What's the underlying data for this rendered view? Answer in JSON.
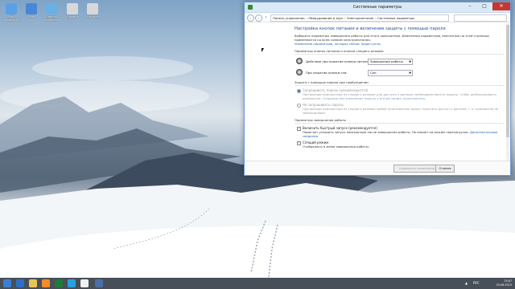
{
  "desktop": {
    "icons": [
      {
        "label": "Этот компьютер",
        "color": "#5aa0e8"
      },
      {
        "label": "Сеть",
        "color": "#4a86d8"
      },
      {
        "label": "Панель управления",
        "color": "#6ab0e6"
      },
      {
        "label": "Корзина",
        "color": "#d8d8d8"
      },
      {
        "label": "Корзина",
        "color": "#d8d8d8"
      }
    ]
  },
  "window": {
    "title": "Системные параметры",
    "breadcrumbs": [
      "Панель управления",
      "Оборудование и звук",
      "Электропитание",
      "Системные параметры"
    ],
    "heading": "Настройка кнопок питания и включение защиты с помощью пароля",
    "intro": "Выберите параметры завершения работы для этого компьютера. Изменения параметров, внесенные на этой странице, применяются ко всем схемам электропитания.",
    "change_link": "Изменение параметров, которые сейчас недоступны",
    "power_section": "Параметры кнопок питания и кнопки спящего режима",
    "power_label": "Действие при нажатии кнопки питания:",
    "power_value": "Завершение работы",
    "sleep_label": "При нажатии кнопки сна:",
    "sleep_value": "Сон",
    "wake_section": "Защита с помощью пароля при пробуждении",
    "require_label": "Запрашивать пароль (рекомендуется)",
    "require_desc": "При выходе компьютера из спящего режима для доступа к данным необходимо ввести пароль, чтобы разблокировать компьютер.",
    "require_link": "Создание или изменение пароля учетной записи пользователя",
    "norequire_label": "Не запрашивать пароль",
    "norequire_desc": "При выходе компьютера из спящего режима любой пользователь может получить доступ к данным, т. к. компьютер не заблокирован.",
    "shutdown_section": "Параметры завершения работы",
    "fast_label": "Включить быстрый запуск (рекомендуется)",
    "fast_desc": "Помогает ускорить запуск компьютера после завершения работы. Не влияет на режим перезагрузки.",
    "fast_link": "Дополнительные сведения",
    "sleep_cb_label": "Спящий режим",
    "sleep_cb_desc": "Отображать в меню завершения работы.",
    "save_label": "Сохранить изменения",
    "cancel_label": "Отмена"
  },
  "taskbar": {
    "lang": "РУС",
    "time": "13:47",
    "date": "03.06.2015"
  }
}
